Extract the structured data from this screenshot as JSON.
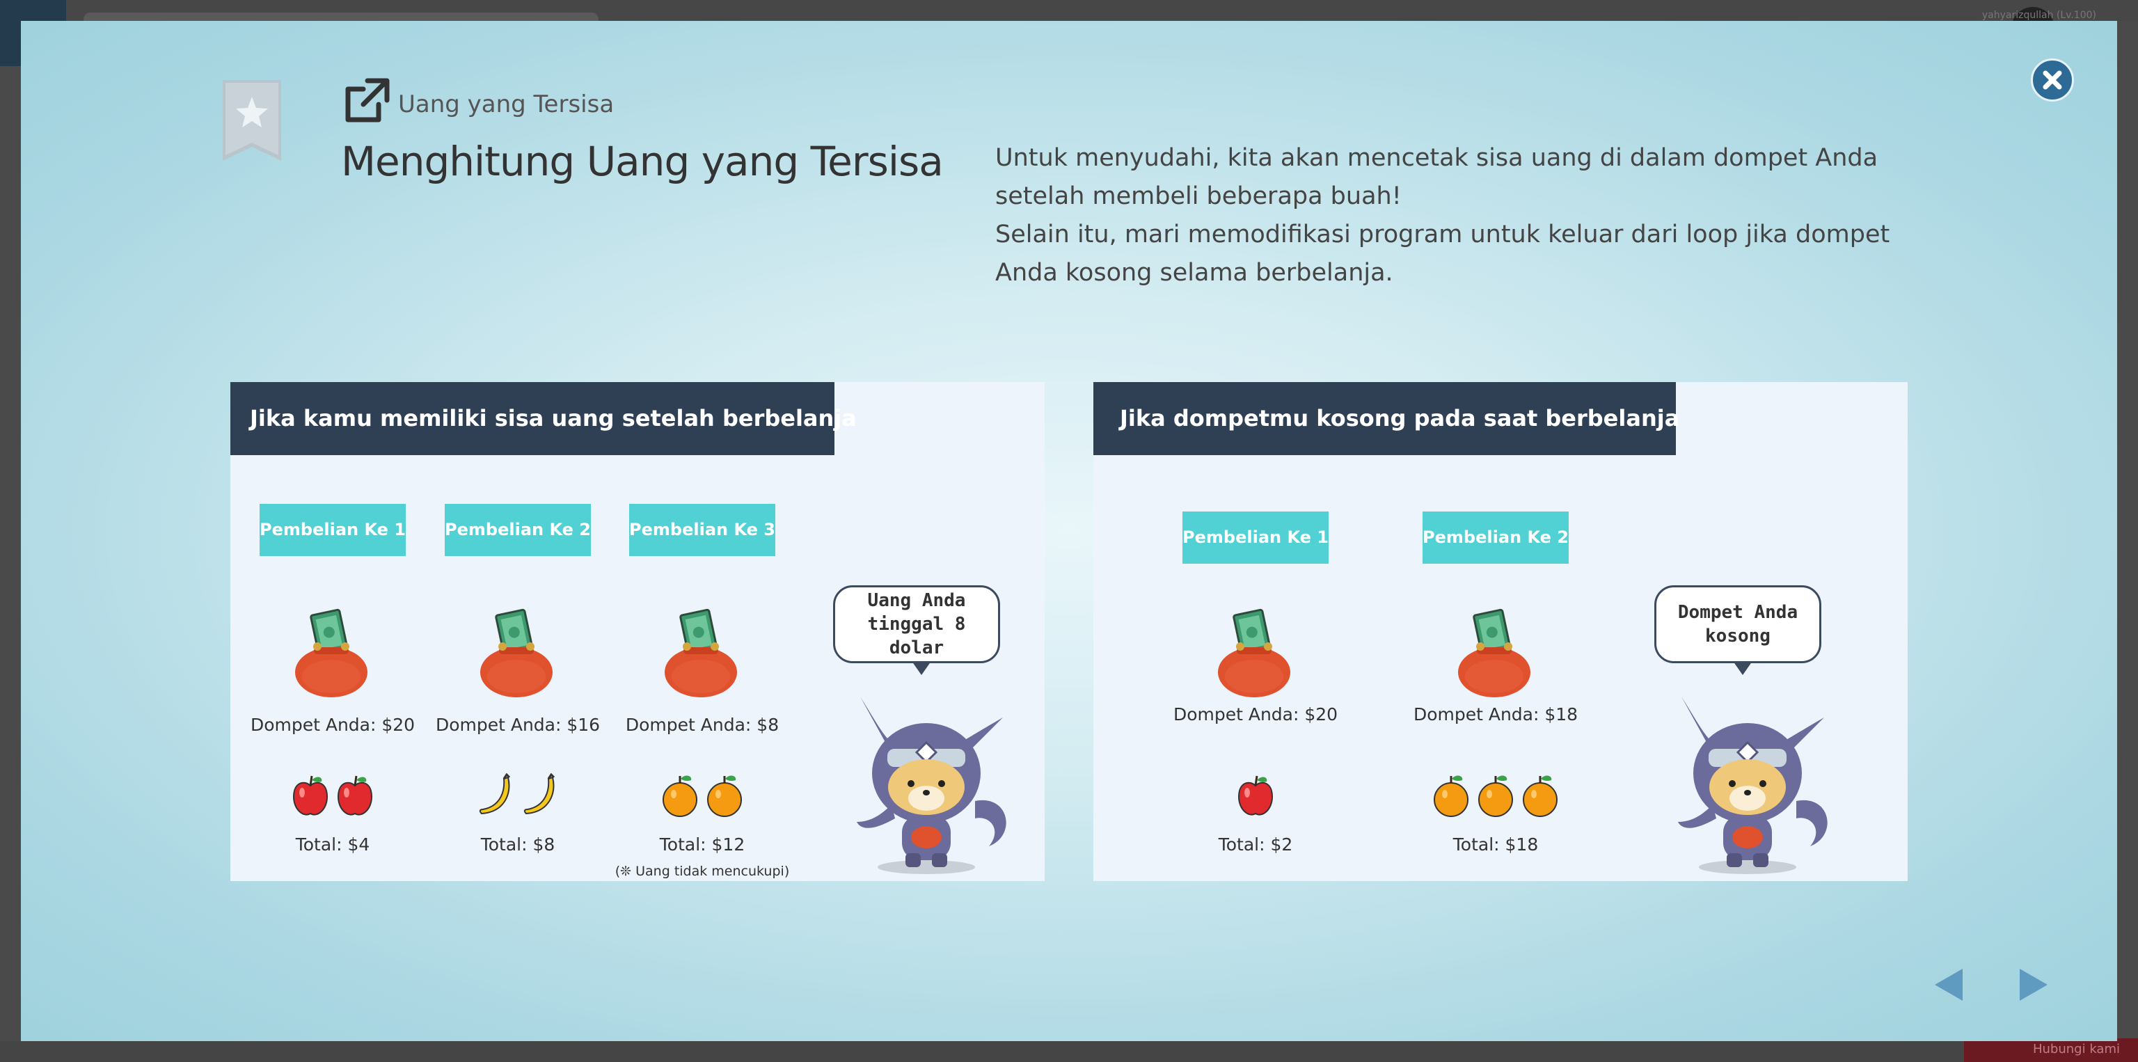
{
  "background_app": {
    "username": "yahyarizqullah (Lv.100)",
    "bottom_button_label": "Hubungi kami"
  },
  "modal": {
    "bookmark_icon": "star-bookmark-icon",
    "section_icon": "external-link-icon",
    "subtitle": "Uang yang Tersisa",
    "title": "Menghitung Uang yang Tersisa",
    "description": [
      "Untuk menyudahi, kita akan mencetak sisa uang di dalam dompet Anda setelah membeli beberapa buah!",
      "Selain itu, mari memodifikasi program untuk keluar dari loop jika dompet Anda kosong selama berbelanja."
    ],
    "close_icon": "close-icon",
    "prev_icon": "arrow-left-icon",
    "next_icon": "arrow-right-icon"
  },
  "panel1": {
    "header": "Jika kamu memiliki sisa uang setelah berbelanja",
    "purchases": [
      {
        "label": "Pembelian Ke 1",
        "wallet": "Dompet Anda: $20",
        "fruit": "apple",
        "count": 2,
        "total": "Total: $4"
      },
      {
        "label": "Pembelian Ke 2",
        "wallet": "Dompet Anda: $16",
        "fruit": "banana",
        "count": 2,
        "total": "Total: $8"
      },
      {
        "label": "Pembelian Ke 3",
        "wallet": "Dompet Anda: $8",
        "fruit": "orange",
        "count": 2,
        "total": "Total: $12"
      }
    ],
    "note": "(❊ Uang tidak mencukupi)",
    "bubble": [
      "Uang Anda",
      "tinggal 8 dolar"
    ]
  },
  "panel2": {
    "header": "Jika dompetmu kosong pada saat berbelanja",
    "purchases": [
      {
        "label": "Pembelian Ke 1",
        "wallet": "Dompet Anda: $20",
        "fruit": "apple",
        "count": 1,
        "total": "Total: $2"
      },
      {
        "label": "Pembelian Ke 2",
        "wallet": "Dompet Anda: $18",
        "fruit": "orange",
        "count": 3,
        "total": "Total: $18"
      }
    ],
    "bubble": [
      "Dompet Anda",
      "kosong"
    ]
  },
  "colors": {
    "panel_header_bg": "#2f4055",
    "badge_bg": "#52d1d4",
    "purse": "#e0512e",
    "close_button": "#2d6a95",
    "nav_arrow": "#5f9ac0"
  }
}
